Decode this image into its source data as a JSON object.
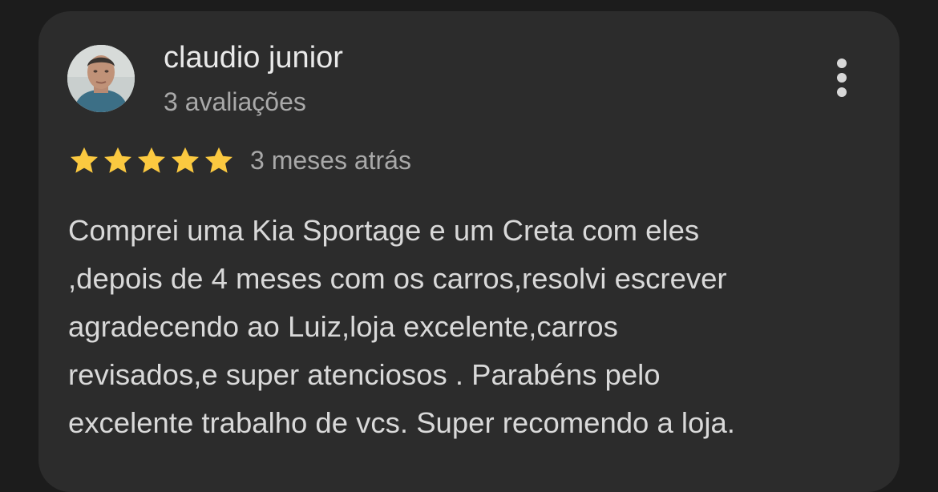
{
  "review": {
    "reviewer_name": "claudio junior",
    "review_count": "3 avaliações",
    "rating": 5,
    "rating_max": 5,
    "date": "3 meses atrás",
    "text_lines": [
      "Comprei uma Kia Sportage e um Creta com eles",
      ",depois de 4 meses com os carros,resolvi escrever",
      "agradecendo ao Luiz,loja excelente,carros",
      "revisados,e super atenciosos . Parabéns pelo",
      "excelente trabalho de vcs. Super recomendo a loja."
    ]
  },
  "icons": {
    "avatar": "user-photo",
    "menu": "more-vertical-icon",
    "star": "star-icon"
  },
  "colors": {
    "background": "#1c1c1c",
    "card": "#2c2c2c",
    "star": "#fbc940",
    "text_primary": "#e9e9e9",
    "text_secondary": "#a9a9a9"
  }
}
